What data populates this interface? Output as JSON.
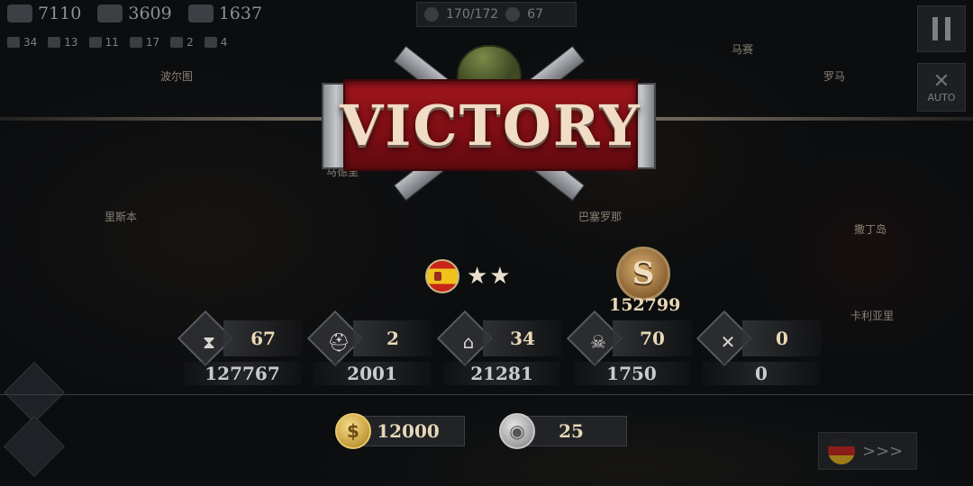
{
  "hud": {
    "resources": [
      {
        "icon": "supply-icon",
        "value": "7110"
      },
      {
        "icon": "steel-icon",
        "value": "3609"
      },
      {
        "icon": "oil-icon",
        "value": "1637"
      }
    ],
    "counts": [
      {
        "icon": "infantry-icon",
        "value": "34"
      },
      {
        "icon": "armor-icon",
        "value": "13"
      },
      {
        "icon": "artillery-icon",
        "value": "11"
      },
      {
        "icon": "navy-icon",
        "value": "17"
      },
      {
        "icon": "aircraft-icon",
        "value": "2"
      },
      {
        "icon": "heart-icon",
        "value": "4"
      }
    ],
    "units": {
      "army": "170/172",
      "generals": "67"
    },
    "auto_label": "AUTO"
  },
  "map_labels": [
    "波尔图",
    "马德里",
    "里斯本",
    "巴塞罗那",
    "马赛",
    "罗马",
    "撒丁岛",
    "卡利亚里"
  ],
  "banner": {
    "title": "VICTORY"
  },
  "player": {
    "flag": "spain-flag",
    "stars": "★★"
  },
  "score": {
    "value": "152799",
    "icon": "score-medal-icon"
  },
  "stats": [
    {
      "name": "stat-turns",
      "icon": "hourglass-icon",
      "glyph": "⧗",
      "top": "67",
      "bottom": "127767"
    },
    {
      "name": "stat-generals",
      "icon": "officer-cap-icon",
      "glyph": "⛑",
      "top": "2",
      "bottom": "2001"
    },
    {
      "name": "stat-cities",
      "icon": "city-icon",
      "glyph": "⌂",
      "top": "34",
      "bottom": "21281"
    },
    {
      "name": "stat-kills",
      "icon": "soldier-icon",
      "glyph": "☠",
      "top": "70",
      "bottom": "1750"
    },
    {
      "name": "stat-losses",
      "icon": "crossed-rifles-icon",
      "glyph": "✕",
      "top": "0",
      "bottom": "0"
    }
  ],
  "rewards": [
    {
      "name": "coins-reward",
      "icon": "gold-coin-icon",
      "glyph": "$",
      "value": "12000"
    },
    {
      "name": "medals-reward",
      "icon": "silver-medal-icon",
      "glyph": "◉",
      "value": "25"
    }
  ],
  "next_turn": {
    "arrows": ">>>",
    "flag": "germany-flag"
  },
  "colors": {
    "ribbon": "#8e1118",
    "gold": "#ead8b5",
    "background": "#141619"
  }
}
